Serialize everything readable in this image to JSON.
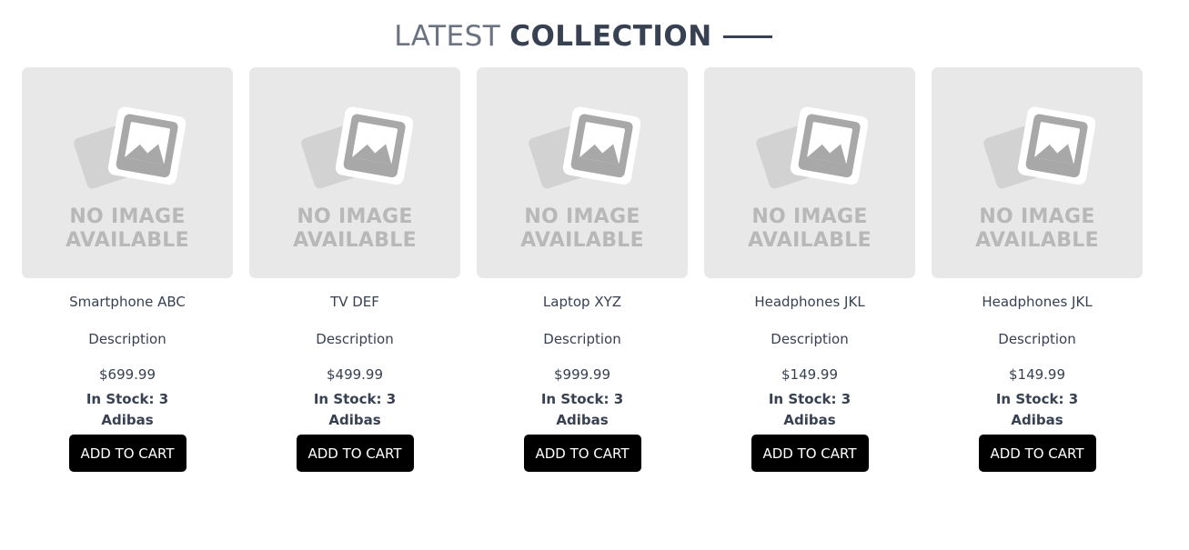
{
  "heading": {
    "light": "LATEST",
    "bold": "COLLECTION"
  },
  "placeholder": {
    "line1": "NO IMAGE",
    "line2": "AVAILABLE"
  },
  "products": [
    {
      "name": "Smartphone ABC",
      "description": "Description",
      "price": "$699.99",
      "stock": "In Stock: 3",
      "brand": "Adibas",
      "button": "ADD TO CART"
    },
    {
      "name": "TV DEF",
      "description": "Description",
      "price": "$499.99",
      "stock": "In Stock: 3",
      "brand": "Adibas",
      "button": "ADD TO CART"
    },
    {
      "name": "Laptop XYZ",
      "description": "Description",
      "price": "$999.99",
      "stock": "In Stock: 3",
      "brand": "Adibas",
      "button": "ADD TO CART"
    },
    {
      "name": "Headphones JKL",
      "description": "Description",
      "price": "$149.99",
      "stock": "In Stock: 3",
      "brand": "Adibas",
      "button": "ADD TO CART"
    },
    {
      "name": "Headphones JKL",
      "description": "Description",
      "price": "$149.99",
      "stock": "In Stock: 3",
      "brand": "Adibas",
      "button": "ADD TO CART"
    }
  ]
}
